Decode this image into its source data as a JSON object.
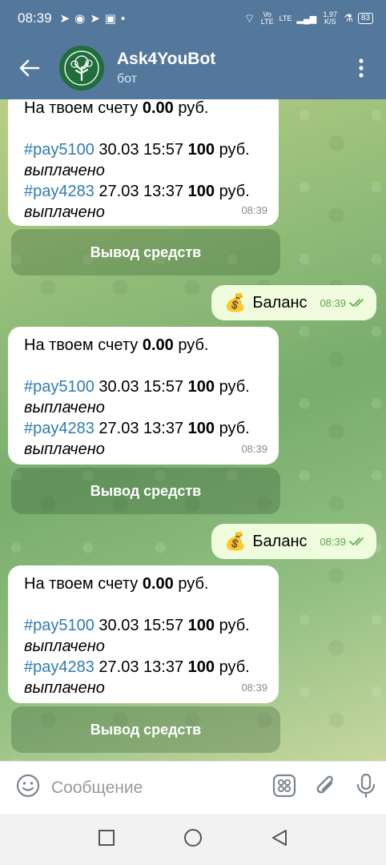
{
  "status": {
    "time": "08:39",
    "net1": "Vo LTE",
    "net2": "LTE",
    "speed": "1,97 K/S",
    "battery": "83"
  },
  "header": {
    "title": "Ask4YouBot",
    "subtitle": "бот"
  },
  "messages": {
    "m1": {
      "balance_prefix": "На твоем счету ",
      "balance_value": "0.00",
      "balance_suffix": " руб.",
      "p1_tag": "#pay5100",
      "p1_date": " 30.03 15:57 ",
      "p1_amount": "100",
      "p1_cur": " руб.",
      "p1_status": "выплачено",
      "p2_tag": "#pay4283",
      "p2_date": " 27.03 13:37 ",
      "p2_amount": "100",
      "p2_cur": " руб.",
      "p2_status": "выплачено",
      "time": "08:39"
    },
    "m2": {
      "balance_prefix": "На твоем счету ",
      "balance_value": "0.00",
      "balance_suffix": " руб.",
      "p1_tag": "#pay5100",
      "p1_date": " 30.03 15:57 ",
      "p1_amount": "100",
      "p1_cur": " руб.",
      "p1_status": "выплачено",
      "p2_tag": "#pay4283",
      "p2_date": " 27.03 13:37 ",
      "p2_amount": "100",
      "p2_cur": " руб.",
      "p2_status": "выплачено",
      "time": "08:39"
    },
    "m3": {
      "balance_prefix": "На твоем счету ",
      "balance_value": "0.00",
      "balance_suffix": " руб.",
      "p1_tag": "#pay5100",
      "p1_date": " 30.03 15:57 ",
      "p1_amount": "100",
      "p1_cur": " руб.",
      "p1_status": "выплачено",
      "p2_tag": "#pay4283",
      "p2_date": " 27.03 13:37 ",
      "p2_amount": "100",
      "p2_cur": " руб.",
      "p2_status": "выплачено",
      "time": "08:39"
    },
    "out1": {
      "emoji": "💰",
      "text": "Баланс",
      "time": "08:39"
    },
    "out2": {
      "emoji": "💰",
      "text": "Баланс",
      "time": "08:39"
    }
  },
  "buttons": {
    "withdraw": "Вывод средств"
  },
  "input": {
    "placeholder": "Сообщение"
  }
}
